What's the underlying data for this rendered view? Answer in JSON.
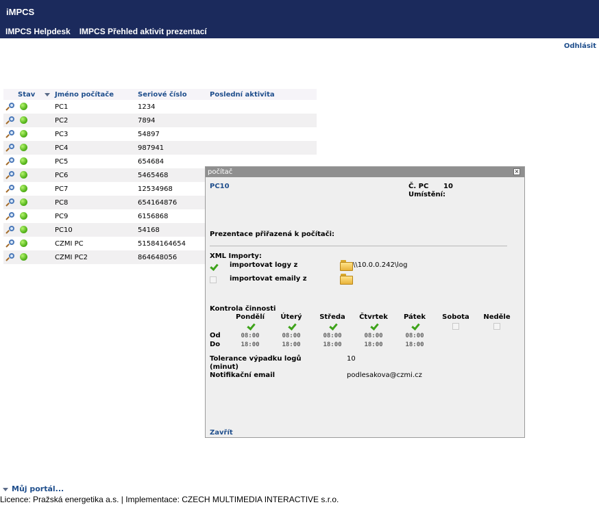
{
  "app": {
    "title": "iMPCS"
  },
  "nav": {
    "items": [
      "IMPCS Helpdesk",
      "IMPCS Přehled aktivit prezentací"
    ]
  },
  "logout": "Odhlásit",
  "table": {
    "columns": {
      "status": "Stav",
      "name": "Jméno počítače",
      "serial": "Seriové číslo",
      "activity": "Poslední aktivita"
    },
    "rows": [
      {
        "name": "PC1",
        "serial": "1234",
        "activity": ""
      },
      {
        "name": "PC2",
        "serial": "7894",
        "activity": ""
      },
      {
        "name": "PC3",
        "serial": "54897",
        "activity": ""
      },
      {
        "name": "PC4",
        "serial": "987941",
        "activity": ""
      },
      {
        "name": "PC5",
        "serial": "654684",
        "activity": ""
      },
      {
        "name": "PC6",
        "serial": "5465468",
        "activity": ""
      },
      {
        "name": "PC7",
        "serial": "12534968",
        "activity": ""
      },
      {
        "name": "PC8",
        "serial": "654164876",
        "activity": ""
      },
      {
        "name": "PC9",
        "serial": "6156868",
        "activity": ""
      },
      {
        "name": "PC10",
        "serial": "54168",
        "activity": ""
      },
      {
        "name": "CZMI PC",
        "serial": "51584164654",
        "activity": ""
      },
      {
        "name": "CZMI PC2",
        "serial": "864648056",
        "activity": ""
      }
    ],
    "status_color": "#56b51c"
  },
  "dialog": {
    "title": "počítač",
    "pc_name": "PC10",
    "pc_number_label": "Č. PC",
    "pc_number": "10",
    "location_label": "Umístění:",
    "presentations_label": "Prezentace přiřazená k počítači:",
    "xml_label": "XML Importy:",
    "imports": [
      {
        "label": "importovat logy z",
        "checked": true,
        "path": "\\\\10.0.0.242\\log"
      },
      {
        "label": "importovat emaily z",
        "checked": false,
        "path": ""
      }
    ],
    "activity_control_label": "Kontrola činnosti",
    "from_label": "Od",
    "to_label": "Do",
    "days": [
      {
        "name": "Pondělí",
        "checked": true,
        "from": "08:00",
        "to": "18:00"
      },
      {
        "name": "Úterý",
        "checked": true,
        "from": "08:00",
        "to": "18:00"
      },
      {
        "name": "Středa",
        "checked": true,
        "from": "08:00",
        "to": "18:00"
      },
      {
        "name": "Čtvrtek",
        "checked": true,
        "from": "08:00",
        "to": "18:00"
      },
      {
        "name": "Pátek",
        "checked": true,
        "from": "08:00",
        "to": "18:00"
      },
      {
        "name": "Sobota",
        "checked": false,
        "from": "",
        "to": ""
      },
      {
        "name": "Neděle",
        "checked": false,
        "from": "",
        "to": ""
      }
    ],
    "tolerance_label": "Tolerance výpadku logů (minut)",
    "tolerance_value": "10",
    "notification_label": "Notifikační email",
    "notification_value": "podlesakova@czmi.cz",
    "close_label": "Zavřít"
  },
  "portal": "Můj portál...",
  "footer": "Licence: Pražská energetika a.s. | Implementace: CZECH MULTIMEDIA INTERACTIVE s.r.o.",
  "colors": {
    "header": "#1b2a5c",
    "link": "#1f4e8c",
    "dialog_titlebar": "#8f8f8f"
  }
}
